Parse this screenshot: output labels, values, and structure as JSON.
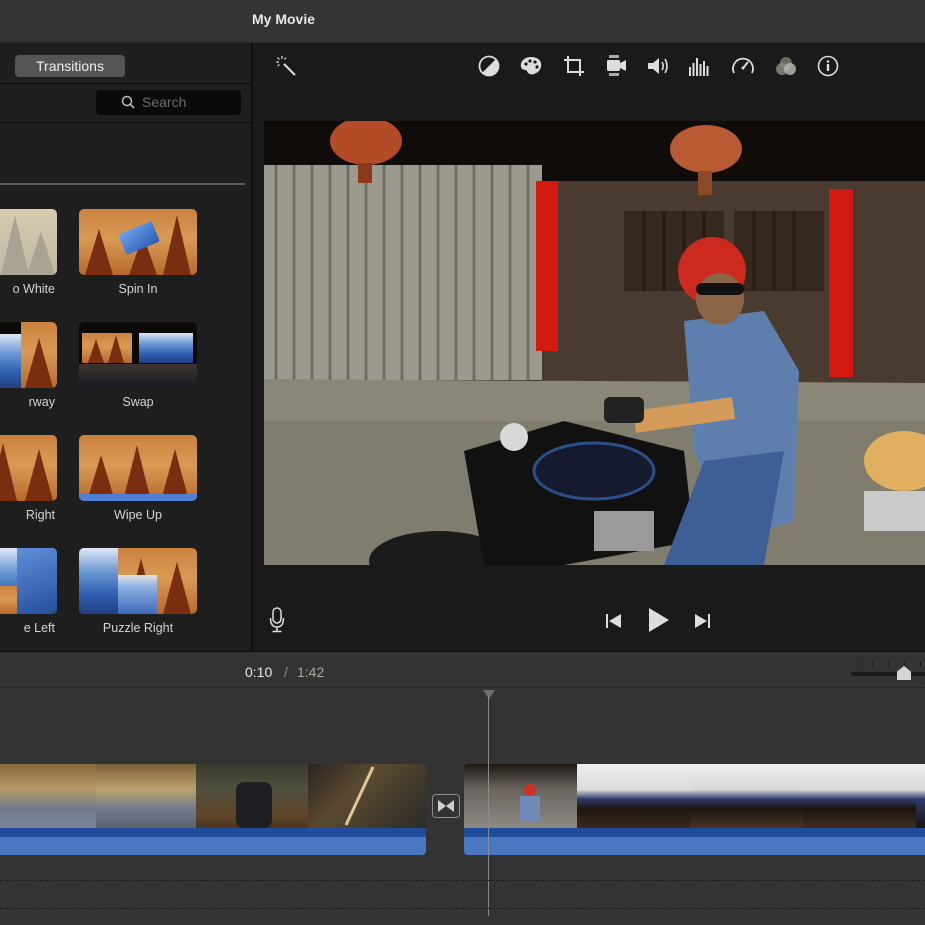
{
  "window": {
    "title": "My Movie"
  },
  "browser": {
    "active_tab": "Transitions",
    "search": {
      "placeholder": "Search",
      "value": "",
      "icon": "search-icon"
    },
    "transitions": [
      {
        "label": "Fade to White",
        "visible_label": "o White",
        "style": "fog"
      },
      {
        "label": "Spin In",
        "visible_label": "Spin In",
        "style": "spin"
      },
      {
        "label": "Doorway",
        "visible_label": "rway",
        "style": "doorway"
      },
      {
        "label": "Swap",
        "visible_label": "Swap",
        "style": "swap"
      },
      {
        "label": "Wipe Right",
        "visible_label": "Right",
        "style": "forest"
      },
      {
        "label": "Wipe Up",
        "visible_label": "Wipe Up",
        "style": "wipeup"
      },
      {
        "label": "Puzzle Left",
        "visible_label": "e Left",
        "style": "puzzleleft"
      },
      {
        "label": "Puzzle Right",
        "visible_label": "Puzzle Right",
        "style": "puzzleright"
      }
    ]
  },
  "viewer": {
    "left_tool": "magic-wand-icon",
    "tools": [
      {
        "name": "color-balance-icon",
        "glyph": "◐"
      },
      {
        "name": "color-correction-icon",
        "glyph": "palette"
      },
      {
        "name": "crop-icon",
        "glyph": "crop"
      },
      {
        "name": "stabilization-icon",
        "glyph": "camera"
      },
      {
        "name": "volume-icon",
        "glyph": "speaker"
      },
      {
        "name": "equalizer-icon",
        "glyph": "bars"
      },
      {
        "name": "speed-icon",
        "glyph": "gauge"
      },
      {
        "name": "clip-filter-icon",
        "glyph": "circles"
      },
      {
        "name": "info-icon",
        "glyph": "i"
      }
    ],
    "controls": {
      "voiceover": "microphone-icon",
      "previous": "skip-back-icon",
      "play": "play-icon",
      "next": "skip-forward-icon"
    }
  },
  "timeline": {
    "current_time": "0:10",
    "separator": "/",
    "total_time": "1:42",
    "zoom_level": 0.75,
    "clips": [
      {
        "name": "clip-park-buffalo",
        "frames": 4
      },
      {
        "name": "clip-motorcycle-plants",
        "frames": 5
      }
    ],
    "transition_icon": "cross-dissolve-icon"
  },
  "colors": {
    "title_bar": "#343434",
    "panel": "#1e1e1e",
    "timeline_bg": "#333333",
    "audio_dark": "#1f4c9c",
    "audio_wave": "#4a78c0",
    "search_bg": "#0a0a0a"
  }
}
